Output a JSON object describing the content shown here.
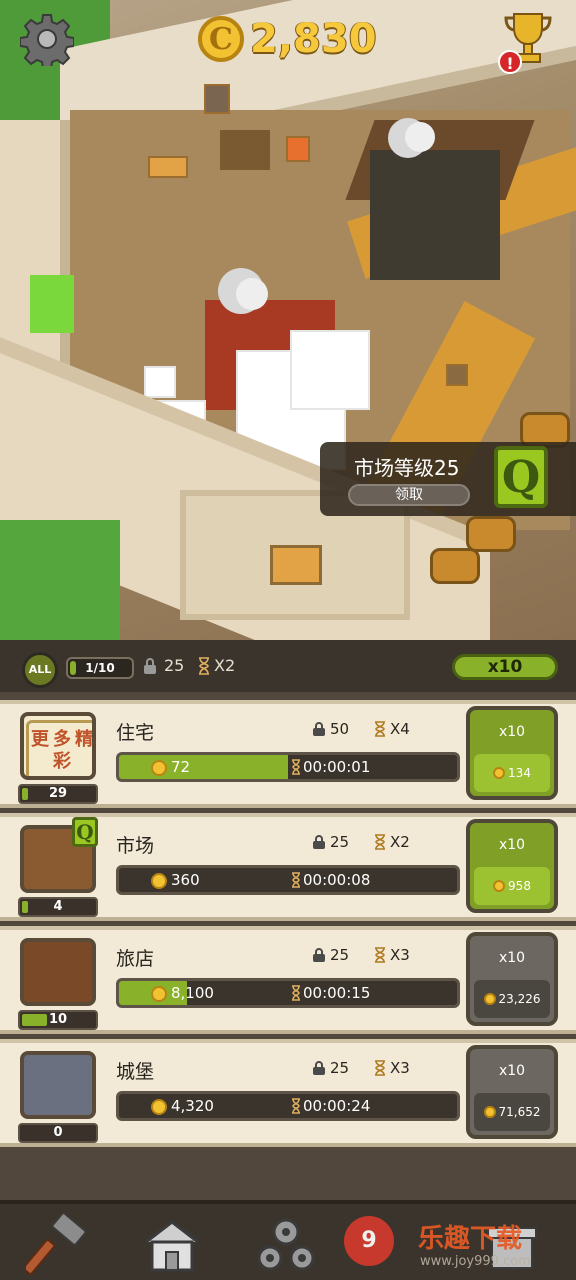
{
  "top": {
    "coins": "2,830",
    "settings_icon": "gear-icon",
    "trophy_icon": "trophy-icon",
    "alert_mark": "!"
  },
  "toast": {
    "title": "市场等级25",
    "button": "领取",
    "badge": "Q"
  },
  "stats": {
    "all_label": "ALL",
    "progress": "1/10",
    "progress_fraction": 0.1,
    "lock_value": "25",
    "multiplier": "X2",
    "x10_label": "x10"
  },
  "buildings": [
    {
      "name": "住宅",
      "level": "29",
      "level_fraction": 0.08,
      "lock": "50",
      "mult": "X4",
      "coins": "72",
      "time": "00:00:01",
      "progress": 0.5,
      "buy_label": "x10",
      "buy_cost": "134",
      "buy_enabled": true,
      "thumb_label": "更多精彩"
    },
    {
      "name": "市场",
      "level": "4",
      "level_fraction": 0.08,
      "lock": "25",
      "mult": "X2",
      "coins": "360",
      "time": "00:00:08",
      "progress": 0.0,
      "buy_label": "x10",
      "buy_cost": "958",
      "buy_enabled": true,
      "badge": "Q"
    },
    {
      "name": "旅店",
      "level": "10",
      "level_fraction": 0.35,
      "lock": "25",
      "mult": "X3",
      "coins": "8,100",
      "time": "00:00:15",
      "progress": 0.2,
      "buy_label": "x10",
      "buy_cost": "23,226",
      "buy_enabled": false
    },
    {
      "name": "城堡",
      "level": "0",
      "level_fraction": 0.0,
      "lock": "25",
      "mult": "X3",
      "coins": "4,320",
      "time": "00:00:24",
      "progress": 0.0,
      "buy_label": "x10",
      "buy_cost": "71,652",
      "buy_enabled": false
    }
  ],
  "nav": {
    "items": [
      "hammer-icon",
      "buildings-icon",
      "gears-icon",
      "shop-icon"
    ]
  },
  "watermark": {
    "logo": "9",
    "text": "乐趣下载",
    "url": "www.joy999.com"
  },
  "colors": {
    "accent_green": "#8ab12a",
    "coin_gold": "#f3c232",
    "panel_bg": "#51473c",
    "card_bg": "#f2ead6"
  }
}
